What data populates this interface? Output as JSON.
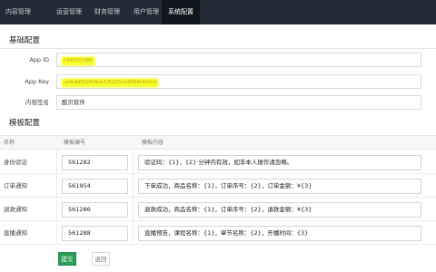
{
  "nav": {
    "items": [
      {
        "label": "内容管理",
        "active": false
      },
      {
        "label": "运营管理",
        "active": false
      },
      {
        "label": "财务管理",
        "active": false
      },
      {
        "label": "用户管理",
        "active": false
      },
      {
        "label": "系统配置",
        "active": true
      }
    ]
  },
  "basic": {
    "title": "基础配置",
    "app_id": {
      "label": "App ID",
      "value": "1400281986"
    },
    "app_key": {
      "label": "App Key",
      "value": "ce3e8d82e8d8ce7c8a53c1e9b88e4b5cd"
    },
    "signature": {
      "label": "内容签名",
      "value": "酷贝软件"
    }
  },
  "templates": {
    "title": "模板配置",
    "headers": {
      "name": "名称",
      "id": "模板编号",
      "content": "模板内容"
    },
    "rows": [
      {
        "name": "身份验证",
        "id": "561282",
        "content": "验证码：{1}，{2} 分钟内有效，如非本人操作请忽略。"
      },
      {
        "name": "订单通知",
        "id": "561954",
        "content": "下单成功，商品名称：{1}，订单序号：{2}，订单金额：¥{3}"
      },
      {
        "name": "退款通知",
        "id": "561286",
        "content": "退款成功，商品名称：{1}，订单序号：{2}，退款金额：¥{3}"
      },
      {
        "name": "直播通知",
        "id": "561288",
        "content": "直播预告，课程名称：{1}，章节名称：{2}，开播时间：{3}"
      }
    ]
  },
  "actions": {
    "submit": "提交",
    "back": "返回"
  },
  "colors": {
    "nav_bg": "#222a35",
    "accent": "#2a9d59",
    "highlight": "#f6ff2e"
  }
}
